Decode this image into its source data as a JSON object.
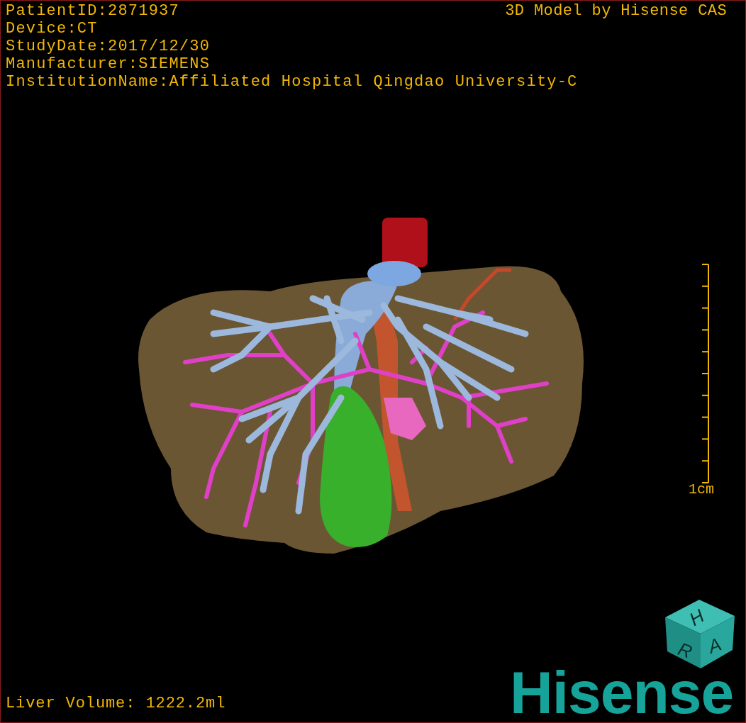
{
  "info_lines": [
    "PatientID:2871937",
    "Device:CT",
    "StudyDate:2017/12/30",
    "Manufacturer:SIEMENS",
    "InstitutionName:Affiliated Hospital Qingdao University-C"
  ],
  "model_credit": "3D Model by Hisense CAS",
  "scale": {
    "label": "1cm"
  },
  "volume": "Liver Volume: 1222.2ml",
  "orientation_cube": {
    "labels": [
      "H",
      "R",
      "A"
    ]
  },
  "logo": "Hisense"
}
